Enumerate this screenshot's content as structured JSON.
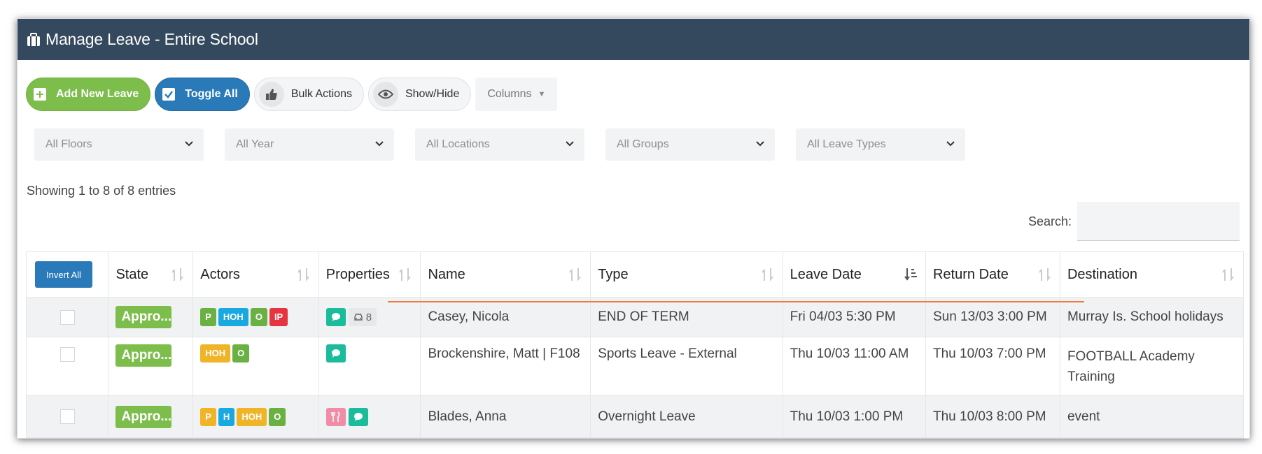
{
  "header": {
    "title": "Manage Leave - Entire School"
  },
  "toolbar": {
    "add_label": "Add New Leave",
    "toggle_label": "Toggle All",
    "bulk_label": "Bulk Actions",
    "showhide_label": "Show/Hide",
    "columns_label": "Columns"
  },
  "filters": [
    "All Floors",
    "All Year",
    "All Locations",
    "All Groups",
    "All Leave Types"
  ],
  "info": "Showing 1 to 8 of 8 entries",
  "search": {
    "label": "Search:",
    "value": ""
  },
  "table": {
    "invert_label": "Invert All",
    "headers": [
      "State",
      "Actors",
      "Properties",
      "Name",
      "Type",
      "Leave Date",
      "Return Date",
      "Destination"
    ],
    "rows": [
      {
        "state": "Appro...",
        "actors": [
          {
            "t": "P",
            "c": "green"
          },
          {
            "t": "HOH",
            "c": "blue"
          },
          {
            "t": "O",
            "c": "green"
          },
          {
            "t": "IP",
            "c": "red"
          }
        ],
        "props": [
          {
            "icon": "chat-icon",
            "c": "teal"
          },
          {
            "icon": "car-icon",
            "c": "grey",
            "text": "8"
          }
        ],
        "name": "Casey, Nicola",
        "type": "END OF TERM",
        "leave": "Fri 04/03 5:30 PM",
        "ret": "Sun 13/03 3:00 PM",
        "dest": "Murray Is. School holidays"
      },
      {
        "state": "Appro...",
        "actors": [
          {
            "t": "HOH",
            "c": "yellow"
          },
          {
            "t": "O",
            "c": "green"
          }
        ],
        "props": [
          {
            "icon": "chat-icon",
            "c": "teal"
          }
        ],
        "name": "Brockenshire, Matt | F108",
        "type": "Sports Leave - External",
        "leave": "Thu 10/03 11:00 AM",
        "ret": "Thu 10/03 7:00 PM",
        "dest": "FOOTBALL Academy Training"
      },
      {
        "state": "Appro...",
        "actors": [
          {
            "t": "P",
            "c": "yellow"
          },
          {
            "t": "H",
            "c": "blue"
          },
          {
            "t": "HOH",
            "c": "yellow"
          },
          {
            "t": "O",
            "c": "green"
          }
        ],
        "props": [
          {
            "icon": "cutlery-icon",
            "c": "pink"
          },
          {
            "icon": "chat-icon",
            "c": "teal"
          }
        ],
        "name": "Blades, Anna",
        "type": "Overnight Leave",
        "leave": "Thu 10/03 1:00 PM",
        "ret": "Thu 10/03 8:00 PM",
        "dest": "event"
      }
    ]
  },
  "colors": {
    "header_bg": "#34495e",
    "green": "#7cbd4b",
    "blue": "#2a7ab9",
    "teal": "#1abc9c",
    "highlight_line": "#ee7a3b"
  }
}
